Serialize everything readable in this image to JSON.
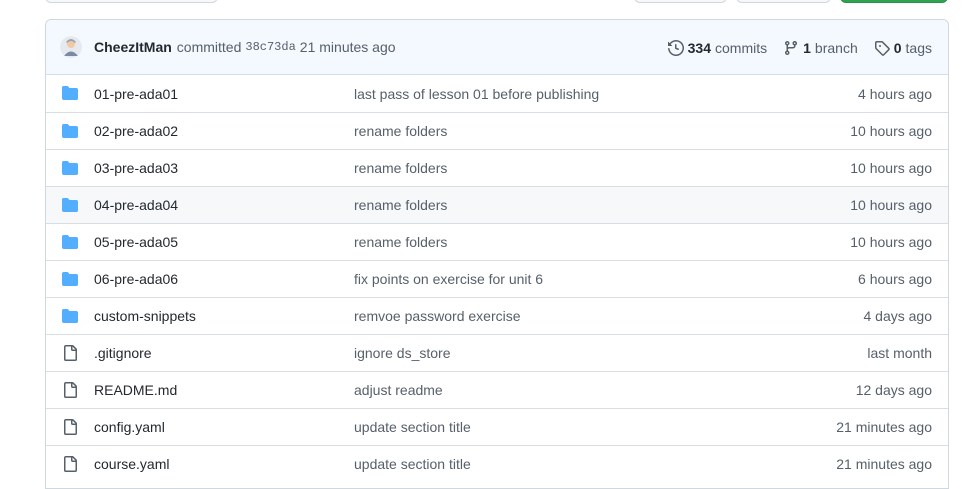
{
  "commit": {
    "author": "CheezItMan",
    "verb": "committed",
    "sha": "38c73da",
    "age": "21 minutes ago"
  },
  "stats": {
    "commits_count": "334",
    "commits_label": "commits",
    "branches_count": "1",
    "branches_label": "branch",
    "tags_count": "0",
    "tags_label": "tags"
  },
  "colors": {
    "folder": "#54aeff",
    "file": "#57606a",
    "accent_green": "#2da44e"
  },
  "files": [
    {
      "type": "folder",
      "icon": "folder-icon",
      "name": "01-pre-ada01",
      "message": "last pass of lesson 01 before publishing",
      "age": "4 hours ago"
    },
    {
      "type": "folder",
      "icon": "folder-icon",
      "name": "02-pre-ada02",
      "message": "rename folders",
      "age": "10 hours ago"
    },
    {
      "type": "folder",
      "icon": "folder-icon",
      "name": "03-pre-ada03",
      "message": "rename folders",
      "age": "10 hours ago"
    },
    {
      "type": "folder",
      "icon": "folder-icon",
      "name": "04-pre-ada04",
      "message": "rename folders",
      "age": "10 hours ago"
    },
    {
      "type": "folder",
      "icon": "folder-icon",
      "name": "05-pre-ada05",
      "message": "rename folders",
      "age": "10 hours ago"
    },
    {
      "type": "folder",
      "icon": "folder-icon",
      "name": "06-pre-ada06",
      "message": "fix points on exercise for unit 6",
      "age": "6 hours ago"
    },
    {
      "type": "folder",
      "icon": "folder-icon",
      "name": "custom-snippets",
      "message": "remvoe password exercise",
      "age": "4 days ago"
    },
    {
      "type": "file",
      "icon": "file-icon",
      "name": ".gitignore",
      "message": "ignore ds_store",
      "age": "last month"
    },
    {
      "type": "file",
      "icon": "file-icon",
      "name": "README.md",
      "message": "adjust readme",
      "age": "12 days ago"
    },
    {
      "type": "file",
      "icon": "file-icon",
      "name": "config.yaml",
      "message": "update section title",
      "age": "21 minutes ago"
    },
    {
      "type": "file",
      "icon": "file-icon",
      "name": "course.yaml",
      "message": "update section title",
      "age": "21 minutes ago"
    }
  ]
}
